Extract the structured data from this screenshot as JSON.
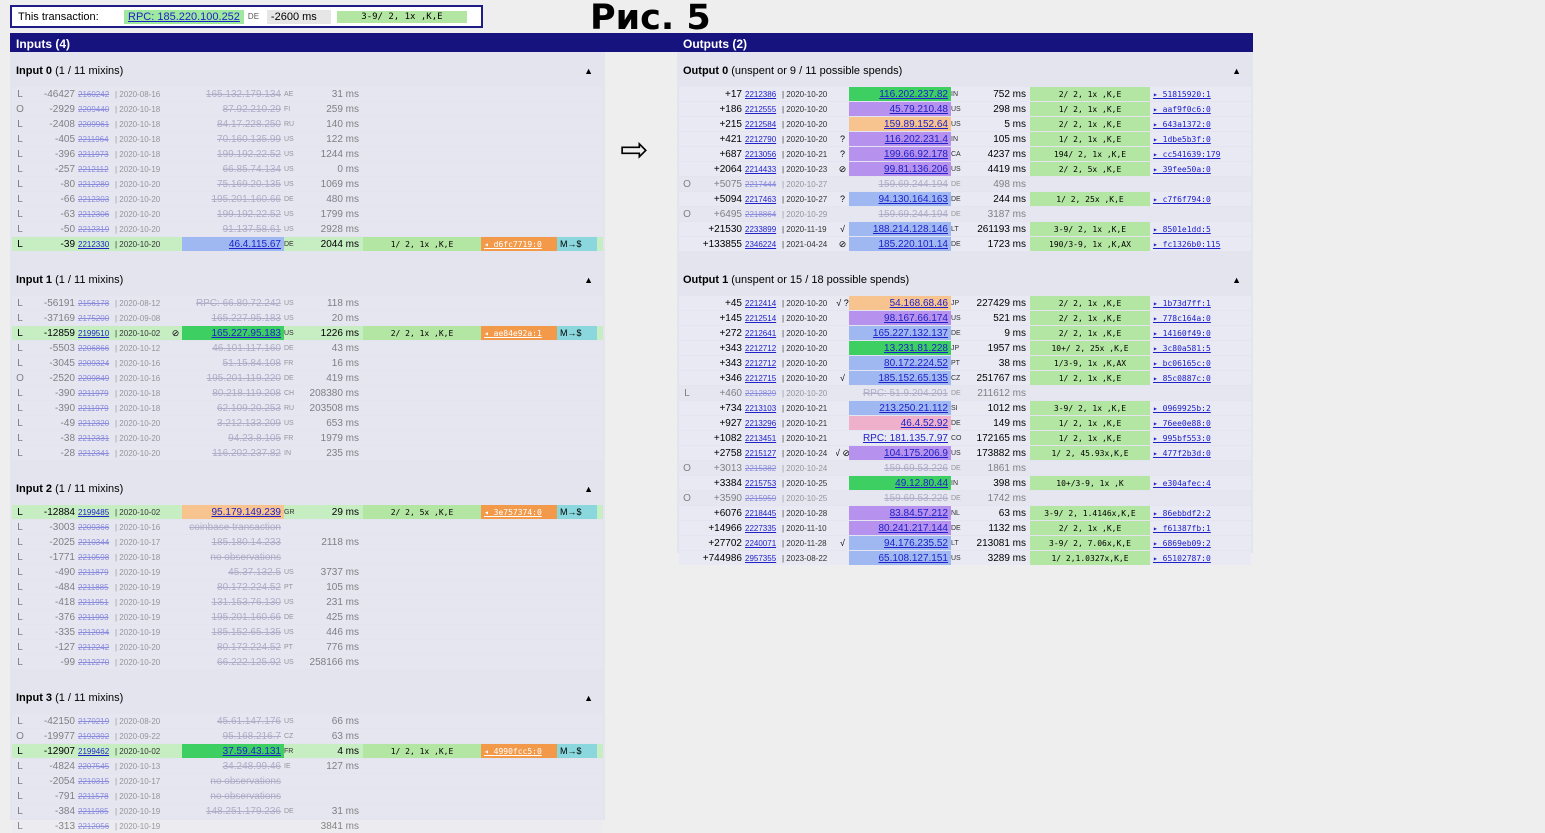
{
  "header": {
    "label": "This transaction:",
    "rpc": "RPC: 185.220.100.252",
    "country": "DE",
    "latency": "-2600 ms",
    "tags": "3-9/ 2, 1x ,K,E"
  },
  "figure_title": "Рис. 5",
  "arrow": "⇨",
  "inputs": {
    "title": "Inputs (4)",
    "groups": [
      {
        "title": "Input 0",
        "sub": "(1 / 11 mixins)",
        "rows": [
          [
            "L",
            "-46427",
            "2160242",
            "2020-08-16",
            "",
            "165.132.179.134",
            "AE",
            "31 ms",
            "",
            "",
            true
          ],
          [
            "O",
            "-2929",
            "2209440",
            "2020-10-18",
            "",
            "87.92.210.29",
            "FI",
            "259 ms",
            "",
            "",
            true
          ],
          [
            "L",
            "-2408",
            "2209961",
            "2020-10-18",
            "",
            "84.17.228.250",
            "RU",
            "140 ms",
            "",
            "",
            true
          ],
          [
            "L",
            "-405",
            "2211964",
            "2020-10-18",
            "",
            "70.160.135.99",
            "US",
            "122 ms",
            "",
            "",
            true
          ],
          [
            "L",
            "-396",
            "2211973",
            "2020-10-18",
            "",
            "199.192.22.52",
            "US",
            "1244 ms",
            "",
            "",
            true
          ],
          [
            "L",
            "-257",
            "2212112",
            "2020-10-19",
            "",
            "66.85.74.134",
            "US",
            "0 ms",
            "",
            "",
            true
          ],
          [
            "L",
            "-80",
            "2212289",
            "2020-10-20",
            "",
            "75.169.20.135",
            "US",
            "1069 ms",
            "",
            "",
            true
          ],
          [
            "L",
            "-66",
            "2212303",
            "2020-10-20",
            "",
            "195.201.160.66",
            "DE",
            "480 ms",
            "",
            "",
            true
          ],
          [
            "L",
            "-63",
            "2212306",
            "2020-10-20",
            "",
            "199.192.22.52",
            "US",
            "1799 ms",
            "",
            "",
            true
          ],
          [
            "L",
            "-50",
            "2212319",
            "2020-10-20",
            "",
            "91.137.58.61",
            "US",
            "2928 ms",
            "",
            "",
            true
          ],
          [
            "L",
            "-39",
            "2212330",
            "2020-10-20",
            "",
            "46.4.115.67",
            "DE",
            "2044 ms",
            "1/ 2, 1x ,K,E",
            "◂ d6fc7719:0",
            false
          ]
        ]
      },
      {
        "title": "Input 1",
        "sub": "(1 / 11 mixins)",
        "rows": [
          [
            "L",
            "-56191",
            "2156178",
            "2020-08-12",
            "",
            "RPC: 66.80.72.242",
            "US",
            "118 ms",
            "",
            "",
            true
          ],
          [
            "L",
            "-37169",
            "2175200",
            "2020-09-08",
            "",
            "165.227.95.183",
            "US",
            "20 ms",
            "",
            "",
            true
          ],
          [
            "L",
            "-12859",
            "2199510",
            "2020-10-02",
            "⊘",
            "165.227.95.183",
            "US",
            "1226 ms",
            "2/ 2, 1x ,K,E",
            "◂ ae84e92a:1",
            false
          ],
          [
            "L",
            "-5503",
            "2206866",
            "2020-10-12",
            "",
            "46.101.117.160",
            "DE",
            "43 ms",
            "",
            "",
            true
          ],
          [
            "L",
            "-3045",
            "2209324",
            "2020-10-16",
            "",
            "51.15.84.108",
            "FR",
            "16 ms",
            "",
            "",
            true
          ],
          [
            "O",
            "-2520",
            "2209849",
            "2020-10-16",
            "",
            "195.201.119.220",
            "DE",
            "419 ms",
            "",
            "",
            true
          ],
          [
            "L",
            "-390",
            "2211979",
            "2020-10-18",
            "",
            "80.218.119.208",
            "CH",
            "208380 ms",
            "",
            "",
            true
          ],
          [
            "L",
            "-390",
            "2211979",
            "2020-10-18",
            "",
            "62.109.20.253",
            "RU",
            "203508 ms",
            "",
            "",
            true
          ],
          [
            "L",
            "-49",
            "2212320",
            "2020-10-20",
            "",
            "3.212.133.209",
            "US",
            "653 ms",
            "",
            "",
            true
          ],
          [
            "L",
            "-38",
            "2212331",
            "2020-10-20",
            "",
            "94.23.8.105",
            "FR",
            "1979 ms",
            "",
            "",
            true
          ],
          [
            "L",
            "-28",
            "2212341",
            "2020-10-20",
            "",
            "116.202.237.82",
            "IN",
            "235 ms",
            "",
            "",
            true
          ]
        ]
      },
      {
        "title": "Input 2",
        "sub": "(1 / 11 mixins)",
        "rows": [
          [
            "L",
            "-12884",
            "2199485",
            "2020-10-02",
            "",
            "95.179.149.239",
            "GR",
            "29 ms",
            "2/ 2, 5x ,K,E",
            "◂ 3e757374:0",
            false
          ],
          [
            "L",
            "-3003",
            "2209366",
            "2020-10-16",
            "",
            "coinbase transaction",
            "",
            "",
            "",
            "",
            true
          ],
          [
            "L",
            "-2025",
            "2210344",
            "2020-10-17",
            "",
            "185.180.14.233",
            "",
            "2118 ms",
            "",
            "",
            true
          ],
          [
            "L",
            "-1771",
            "2210598",
            "2020-10-18",
            "",
            "no observations",
            "",
            "",
            "",
            "",
            true
          ],
          [
            "L",
            "-490",
            "2211879",
            "2020-10-19",
            "",
            "45.37.132.5",
            "US",
            "3737 ms",
            "",
            "",
            true
          ],
          [
            "L",
            "-484",
            "2211885",
            "2020-10-19",
            "",
            "80.172.224.52",
            "PT",
            "105 ms",
            "",
            "",
            true
          ],
          [
            "L",
            "-418",
            "2211951",
            "2020-10-19",
            "",
            "131.153.76.130",
            "US",
            "231 ms",
            "",
            "",
            true
          ],
          [
            "L",
            "-376",
            "2211993",
            "2020-10-19",
            "",
            "195.201.160.66",
            "DE",
            "425 ms",
            "",
            "",
            true
          ],
          [
            "L",
            "-335",
            "2212034",
            "2020-10-19",
            "",
            "185.152.65.135",
            "US",
            "446 ms",
            "",
            "",
            true
          ],
          [
            "L",
            "-127",
            "2212242",
            "2020-10-20",
            "",
            "80.172.224.52",
            "PT",
            "776 ms",
            "",
            "",
            true
          ],
          [
            "L",
            "-99",
            "2212270",
            "2020-10-20",
            "",
            "66.222.125.92",
            "US",
            "258166 ms",
            "",
            "",
            true
          ]
        ]
      },
      {
        "title": "Input 3",
        "sub": "(1 / 11 mixins)",
        "rows": [
          [
            "L",
            "-42150",
            "2170219",
            "2020-08-20",
            "",
            "45.61.147.176",
            "US",
            "66 ms",
            "",
            "",
            true
          ],
          [
            "O",
            "-19977",
            "2192392",
            "2020-09-22",
            "",
            "95.168.216.7",
            "CZ",
            "63 ms",
            "",
            "",
            true
          ],
          [
            "L",
            "-12907",
            "2199462",
            "2020-10-02",
            "",
            "37.59.43.131",
            "FR",
            "4 ms",
            "1/ 2, 1x ,K,E",
            "◂ 4990fcc5:0",
            false
          ],
          [
            "L",
            "-4824",
            "2207545",
            "2020-10-13",
            "",
            "34.248.99.46",
            "IE",
            "127 ms",
            "",
            "",
            true
          ],
          [
            "L",
            "-2054",
            "2210315",
            "2020-10-17",
            "",
            "no observations",
            "",
            "",
            "",
            "",
            true
          ],
          [
            "L",
            "-791",
            "2211578",
            "2020-10-18",
            "",
            "no observations",
            "",
            "",
            "",
            "",
            true
          ],
          [
            "L",
            "-384",
            "2211985",
            "2020-10-19",
            "",
            "148.251.179.236",
            "DE",
            "31 ms",
            "",
            "",
            true
          ],
          [
            "L",
            "-313",
            "2212056",
            "2020-10-19",
            "",
            "",
            "",
            "3841 ms",
            "",
            "",
            true
          ]
        ]
      }
    ]
  },
  "outputs": {
    "title": "Outputs (2)",
    "groups": [
      {
        "title": "Output 0",
        "sub": "(unspent or 9 / 11 possible spends)",
        "rows": [
          [
            "",
            "+17",
            "2212386",
            "2020-10-20",
            "",
            "116.202.237.82",
            "IN",
            "752 ms",
            "2/ 2, 1x ,K,E",
            "▸ 51815920:1",
            false
          ],
          [
            "",
            "+186",
            "2212555",
            "2020-10-20",
            "",
            "45.79.210.48",
            "US",
            "298 ms",
            "1/ 2, 1x ,K,E",
            "▸ aaf9f0c6:0",
            false
          ],
          [
            "",
            "+215",
            "2212584",
            "2020-10-20",
            "",
            "159.89.152.64",
            "US",
            "5 ms",
            "2/ 2, 1x ,K,E",
            "▸ 643a1372:0",
            false
          ],
          [
            "",
            "+421",
            "2212790",
            "2020-10-20",
            "?",
            "116.202.231.4",
            "IN",
            "105 ms",
            "1/ 2, 1x ,K,E",
            "▸ 1dbe5b3f:0",
            false
          ],
          [
            "",
            "+687",
            "2213056",
            "2020-10-21",
            "?",
            "199.66.92.178",
            "CA",
            "4237 ms",
            "194/ 2, 1x ,K,E",
            "▸ cc541639:179",
            false
          ],
          [
            "",
            "+2064",
            "2214433",
            "2020-10-23",
            "⊘",
            "99.81.136.206",
            "US",
            "4419 ms",
            "2/ 2, 5x ,K,E",
            "▸ 39fee50a:0",
            false
          ],
          [
            "O",
            "+5075",
            "2217444",
            "2020-10-27",
            "",
            "159.69.244.194",
            "DE",
            "498 ms",
            "",
            "",
            true
          ],
          [
            "",
            "+5094",
            "2217463",
            "2020-10-27",
            "?",
            "94.130.164.163",
            "DE",
            "244 ms",
            "1/ 2, 25x ,K,E",
            "▸ c7f6f794:0",
            false
          ],
          [
            "O",
            "+6495",
            "2218864",
            "2020-10-29",
            "",
            "159.69.244.194",
            "DE",
            "3187 ms",
            "",
            "",
            true
          ],
          [
            "",
            "+21530",
            "2233899",
            "2020-11-19",
            "√",
            "188.214.128.146",
            "LT",
            "261193 ms",
            "3-9/ 2, 1x ,K,E",
            "▸ 8501e1dd:5",
            false
          ],
          [
            "",
            "+133855",
            "2346224",
            "2021-04-24",
            "⊘",
            "185.220.101.14",
            "DE",
            "1723 ms",
            "190/3-9, 1x ,K,AX",
            "▸ fc1326b0:115",
            false
          ]
        ]
      },
      {
        "title": "Output 1",
        "sub": "(unspent or 15 / 18 possible spends)",
        "rows": [
          [
            "",
            "+45",
            "2212414",
            "2020-10-20",
            "√ ?",
            "54.168.68.46",
            "JP",
            "227429 ms",
            "2/ 2, 1x ,K,E",
            "▸ 1b73d7ff:1",
            false
          ],
          [
            "",
            "+145",
            "2212514",
            "2020-10-20",
            "",
            "98.167.66.174",
            "US",
            "521 ms",
            "2/ 2, 1x ,K,E",
            "▸ 778c164a:0",
            false
          ],
          [
            "",
            "+272",
            "2212641",
            "2020-10-20",
            "",
            "165.227.132.137",
            "DE",
            "9 ms",
            "2/ 2, 1x ,K,E",
            "▸ 14160f49:0",
            false
          ],
          [
            "",
            "+343",
            "2212712",
            "2020-10-20",
            "",
            "13.231.81.228",
            "JP",
            "1957 ms",
            "10+/ 2, 25x ,K,E",
            "▸ 3c80a581:5",
            false
          ],
          [
            "",
            "+343",
            "2212712",
            "2020-10-20",
            "",
            "80.172.224.52",
            "PT",
            "38 ms",
            "1/3-9, 1x ,K,AX",
            "▸ bc06165c:0",
            false
          ],
          [
            "",
            "+346",
            "2212715",
            "2020-10-20",
            "√",
            "185.152.65.135",
            "CZ",
            "251767 ms",
            "1/ 2, 1x ,K,E",
            "▸ 85c0887c:0",
            false
          ],
          [
            "L",
            "+460",
            "2212829",
            "2020-10-20",
            "",
            "RPC: 51.9.204.201",
            "DE",
            "211612 ms",
            "",
            "",
            true
          ],
          [
            "",
            "+734",
            "2213103",
            "2020-10-21",
            "",
            "213.250.21.112",
            "SI",
            "1012 ms",
            "3-9/ 2, 1x ,K,E",
            "▸ 0969925b:2",
            false
          ],
          [
            "",
            "+927",
            "2213296",
            "2020-10-21",
            "",
            "46.4.52.92",
            "DE",
            "149 ms",
            "1/ 2, 1x ,K,E",
            "▸ 76ee0e88:0",
            false
          ],
          [
            "",
            "+1082",
            "2213451",
            "2020-10-21",
            "",
            "RPC: 181.135.7.97",
            "CO",
            "172165 ms",
            "1/ 2, 1x ,K,E",
            "▸ 995bf553:0",
            false
          ],
          [
            "",
            "+2758",
            "2215127",
            "2020-10-24",
            "√ ⊘",
            "104.175.206.9",
            "US",
            "173882 ms",
            "1/ 2, 45.93x,K,E",
            "▸ 477f2b3d:0",
            false
          ],
          [
            "O",
            "+3013",
            "2215382",
            "2020-10-24",
            "",
            "159.69.53.226",
            "DE",
            "1861 ms",
            "",
            "",
            true
          ],
          [
            "",
            "+3384",
            "2215753",
            "2020-10-25",
            "",
            "49.12.80.44",
            "IN",
            "398 ms",
            "10+/3-9, 1x ,K",
            "▸ e304afec:4",
            false
          ],
          [
            "O",
            "+3590",
            "2215959",
            "2020-10-25",
            "",
            "159.69.53.226",
            "DE",
            "1742 ms",
            "",
            "",
            true
          ],
          [
            "",
            "+6076",
            "2218445",
            "2020-10-28",
            "",
            "83.84.57.212",
            "NL",
            "63 ms",
            "3-9/ 2, 1.4146x,K,E",
            "▸ 86ebbdf2:2",
            false
          ],
          [
            "",
            "+14966",
            "2227335",
            "2020-11-10",
            "",
            "80.241.217.144",
            "DE",
            "1132 ms",
            "2/ 2, 1x ,K,E",
            "▸ f61387fb:1",
            false
          ],
          [
            "",
            "+27702",
            "2240071",
            "2020-11-28",
            "√",
            "94.176.235.52",
            "LT",
            "213081 ms",
            "3-9/ 2, 7.06x,K,E",
            "▸ 6869eb09:2",
            false
          ],
          [
            "",
            "+744986",
            "2957355",
            "2023-08-22",
            "",
            "65.108.127.151",
            "US",
            "3289 ms",
            "1/ 2,1.0327x,K,E",
            "▸ 65102787:0",
            false
          ]
        ]
      }
    ]
  },
  "row_extras": {
    "in0_last": "M→$",
    "in1_hl": "M→$",
    "in2_first": "M→$",
    "in3_hl": "M→$"
  },
  "colors": {
    "panel_head": "#17137e",
    "panel_bg": "#cdcde9",
    "link": "#1f21c8",
    "ip_green": "#3ecf63",
    "ip_purple": "#b691ee",
    "ip_orange": "#f7c48f",
    "ip_pink": "#efb0cc",
    "ip_blue": "#9fb8f2",
    "tag_green": "#b4e6a3",
    "link_orange": "#f39a4a",
    "extra_teal": "#8ad8de"
  }
}
